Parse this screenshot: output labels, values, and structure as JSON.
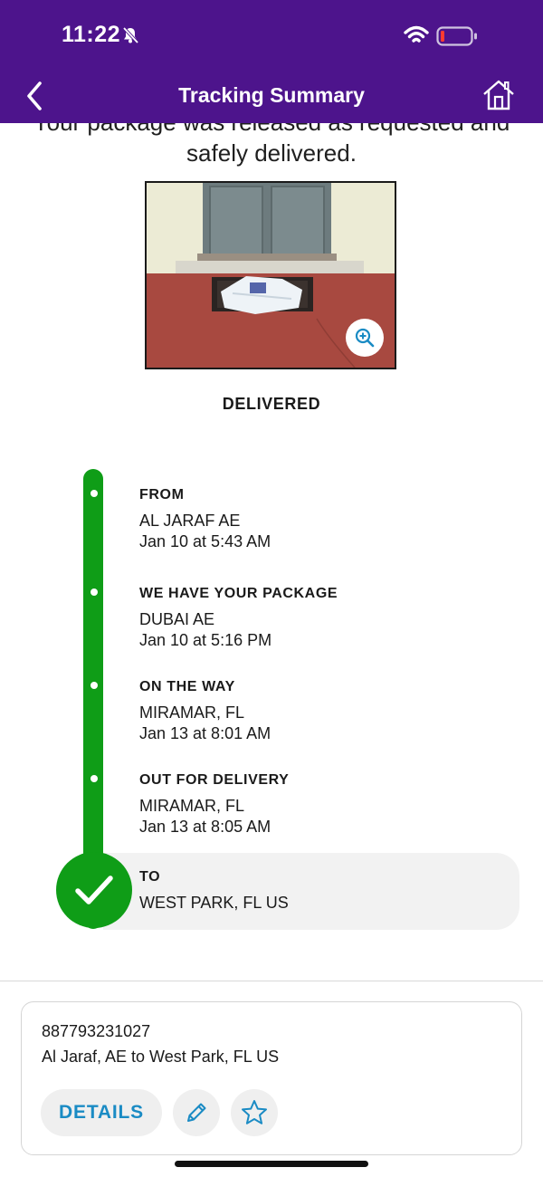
{
  "status_bar": {
    "time": "11:22"
  },
  "header": {
    "title": "Tracking Summary",
    "back_icon": "chevron-left-icon",
    "home_icon": "home-icon"
  },
  "delivery": {
    "message_line1": "Your package was released as requested and",
    "message_line2": "safely delivered.",
    "status": "DELIVERED"
  },
  "timeline": [
    {
      "title": "FROM",
      "line1": "AL JARAF AE",
      "line2": "Jan 10 at 5:43 AM"
    },
    {
      "title": "WE HAVE YOUR PACKAGE",
      "line1": "DUBAI AE",
      "line2": "Jan 10 at 5:16 PM"
    },
    {
      "title": "ON THE WAY",
      "line1": "MIRAMAR, FL",
      "line2": "Jan 13 at 8:01 AM"
    },
    {
      "title": "OUT FOR DELIVERY",
      "line1": "MIRAMAR, FL",
      "line2": "Jan 13 at 8:05 AM"
    },
    {
      "title": "TO",
      "line1": "WEST PARK, FL  US"
    }
  ],
  "shipment_card": {
    "tracking_number": "887793231027",
    "route": "Al Jaraf, AE to West Park, FL US",
    "details_label": "DETAILS",
    "edit_icon": "pencil-icon",
    "favorite_icon": "star-icon"
  },
  "colors": {
    "brand_purple": "#4d148c",
    "progress_green": "#0f9d17",
    "link_blue": "#1a8bc4"
  }
}
